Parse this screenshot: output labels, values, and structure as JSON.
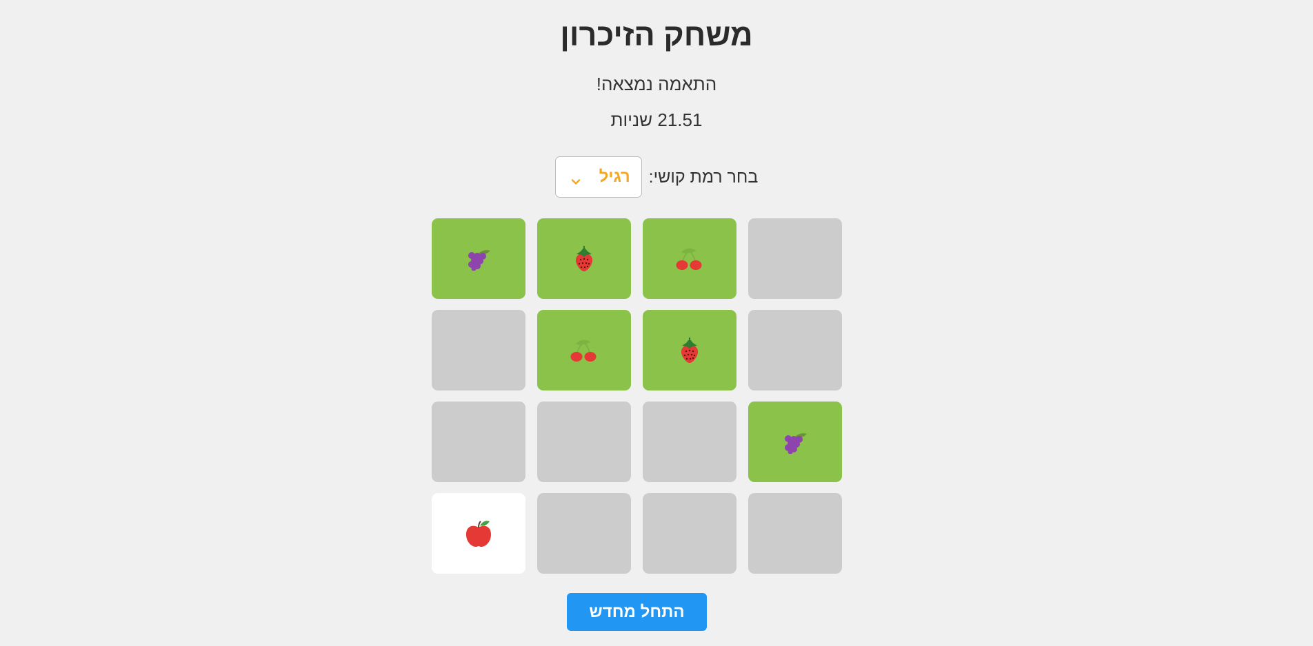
{
  "game": {
    "title": "משחק הזיכרון",
    "status": "התאמה נמצאה!",
    "timer_value": "21.51",
    "timer_unit": "שניות"
  },
  "difficulty": {
    "label": "בחר רמת קושי:",
    "selected": "רגיל",
    "accent_color": "#f5a623"
  },
  "board": {
    "columns": 4,
    "rows": 4,
    "matched_color": "#8bc34a",
    "hidden_color": "#cccccc",
    "revealed_color": "#ffffff",
    "cards": [
      {
        "state": "matched",
        "fruit": "grapes-icon"
      },
      {
        "state": "matched",
        "fruit": "strawberry-icon"
      },
      {
        "state": "matched",
        "fruit": "cherries-icon"
      },
      {
        "state": "hidden",
        "fruit": ""
      },
      {
        "state": "hidden",
        "fruit": ""
      },
      {
        "state": "matched",
        "fruit": "cherries-icon"
      },
      {
        "state": "matched",
        "fruit": "strawberry-icon"
      },
      {
        "state": "hidden",
        "fruit": ""
      },
      {
        "state": "hidden",
        "fruit": ""
      },
      {
        "state": "hidden",
        "fruit": ""
      },
      {
        "state": "hidden",
        "fruit": ""
      },
      {
        "state": "matched",
        "fruit": "grapes-icon"
      },
      {
        "state": "revealed",
        "fruit": "apple-icon"
      },
      {
        "state": "hidden",
        "fruit": ""
      },
      {
        "state": "hidden",
        "fruit": ""
      },
      {
        "state": "hidden",
        "fruit": ""
      }
    ]
  },
  "controls": {
    "restart_label": "התחל מחדש",
    "restart_color": "#2196f3"
  }
}
